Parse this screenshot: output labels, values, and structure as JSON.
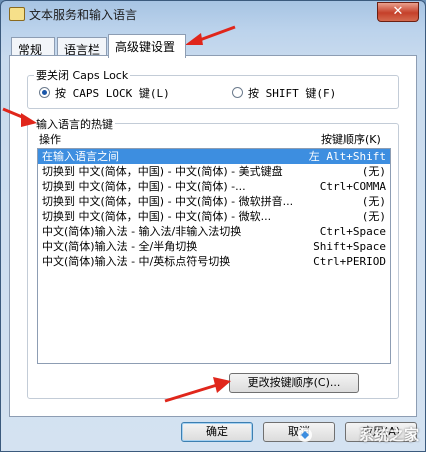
{
  "window": {
    "title": "文本服务和输入语言",
    "close_label": "✕"
  },
  "tabs": [
    {
      "label": "常规",
      "active": false
    },
    {
      "label": "语言栏",
      "active": false
    },
    {
      "label": "高级键设置",
      "active": true
    }
  ],
  "capslock": {
    "title": "要关闭 Caps Lock",
    "options": [
      {
        "label": "按 CAPS LOCK 键(L)",
        "checked": true
      },
      {
        "label": "按 SHIFT 键(F)",
        "checked": false
      }
    ]
  },
  "hotkeys": {
    "title": "输入语言的热键",
    "col_action": "操作",
    "col_keys": "按键顺序(K)",
    "rows": [
      {
        "action": "在输入语言之间",
        "keys": "左 Alt+Shift",
        "selected": true
      },
      {
        "action": "切换到 中文(简体，中国) - 中文(简体) - 美式键盘",
        "keys": "(无)",
        "selected": false
      },
      {
        "action": "切换到 中文(简体，中国) - 中文(简体) -...",
        "keys": "Ctrl+COMMA",
        "selected": false
      },
      {
        "action": "切换到 中文(简体，中国) - 中文(简体) - 微软拼音...",
        "keys": "(无)",
        "selected": false
      },
      {
        "action": "切换到 中文(简体，中国) - 中文(简体) - 微软...",
        "keys": "(无)",
        "selected": false
      },
      {
        "action": "中文(简体)输入法 - 输入法/非输入法切换",
        "keys": "Ctrl+Space",
        "selected": false
      },
      {
        "action": "中文(简体)输入法 - 全/半角切换",
        "keys": "Shift+Space",
        "selected": false
      },
      {
        "action": "中文(简体)输入法 - 中/英标点符号切换",
        "keys": "Ctrl+PERIOD",
        "selected": false
      }
    ],
    "change_button": "更改按键顺序(C)..."
  },
  "footer": {
    "ok": "确定",
    "cancel": "取消",
    "apply": "应用(A)"
  },
  "watermark": "系统之家",
  "colors": {
    "selection": "#3d8ee0",
    "arrow": "#e0261b",
    "close": "#c5402a"
  }
}
